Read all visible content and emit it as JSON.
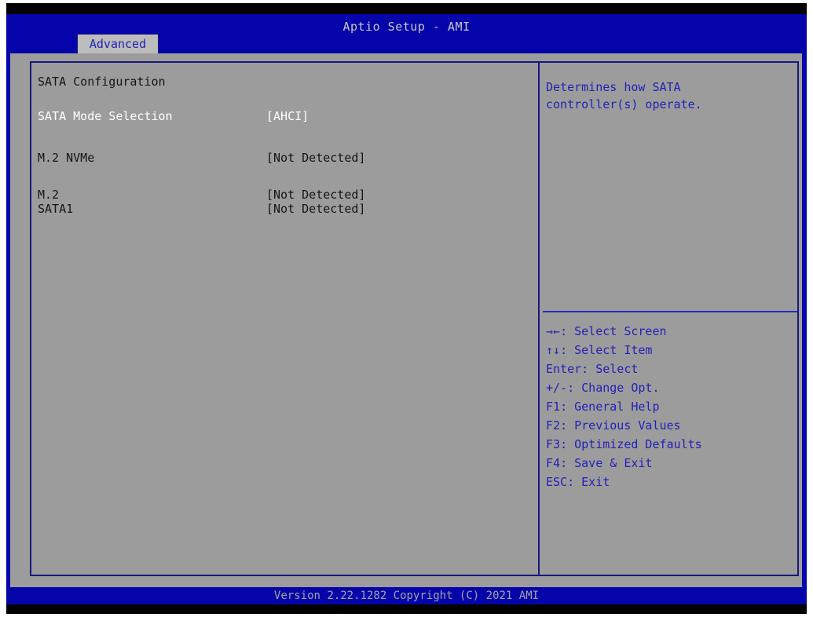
{
  "header": {
    "title": "Aptio Setup - AMI"
  },
  "tabs": [
    {
      "label": "Advanced"
    }
  ],
  "main": {
    "section_title": "SATA Configuration",
    "items": [
      {
        "label": "SATA Mode Selection",
        "value": "[AHCI]",
        "selected": true
      },
      {
        "label": "M.2 NVMe",
        "value": "[Not Detected]",
        "selected": false
      },
      {
        "label": "M.2",
        "value": "[Not Detected]",
        "selected": false
      },
      {
        "label": "SATA1",
        "value": "[Not Detected]",
        "selected": false
      }
    ]
  },
  "help_panel": {
    "description_line1": "Determines how SATA",
    "description_line2": "controller(s) operate.",
    "key_separator": ": ",
    "keys": [
      {
        "key": "→←",
        "action": "Select Screen"
      },
      {
        "key": "↑↓",
        "action": "Select Item"
      },
      {
        "key": "Enter",
        "action": "Select"
      },
      {
        "key": "+/-",
        "action": "Change Opt."
      },
      {
        "key": "F1",
        "action": "General Help"
      },
      {
        "key": "F2",
        "action": "Previous Values"
      },
      {
        "key": "F3",
        "action": "Optimized Defaults"
      },
      {
        "key": "F4",
        "action": "Save & Exit"
      },
      {
        "key": "ESC",
        "action": "Exit"
      }
    ]
  },
  "footer": {
    "version_text": "Version 2.22.1282 Copyright (C) 2021 AMI"
  },
  "colors": {
    "header_blue": "#0504aa",
    "content_gray": "#9c9c9c",
    "panel_border_navy": "#17177f",
    "help_text_blue": "#2222b6",
    "selected_text": "#ffffff",
    "normal_text": "#151515"
  }
}
